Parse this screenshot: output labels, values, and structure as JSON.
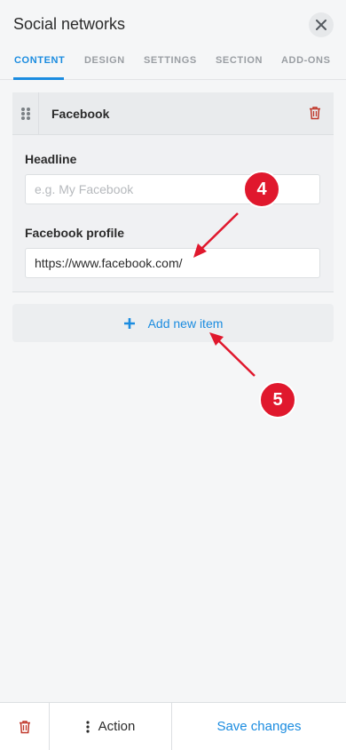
{
  "panel": {
    "title": "Social networks"
  },
  "tabs": [
    {
      "label": "CONTENT",
      "active": true
    },
    {
      "label": "DESIGN",
      "active": false
    },
    {
      "label": "SETTINGS",
      "active": false
    },
    {
      "label": "SECTION",
      "active": false
    },
    {
      "label": "ADD-ONS",
      "active": false
    }
  ],
  "item": {
    "title": "Facebook",
    "headline_label": "Headline",
    "headline_value": "",
    "headline_placeholder": "e.g. My Facebook",
    "profile_label": "Facebook profile",
    "profile_value": "https://www.facebook.com/"
  },
  "add_item": {
    "label": "Add new item"
  },
  "annotations": [
    {
      "number": "4"
    },
    {
      "number": "5"
    }
  ],
  "footer": {
    "action_label": "Action",
    "save_label": "Save changes"
  },
  "colors": {
    "accent": "#1b8ce0",
    "delete": "#c0392b",
    "annotation": "#e0182d"
  },
  "icons": [
    "close-icon",
    "drag-handle-icon",
    "trash-icon",
    "plus-icon",
    "more-vertical-icon"
  ]
}
